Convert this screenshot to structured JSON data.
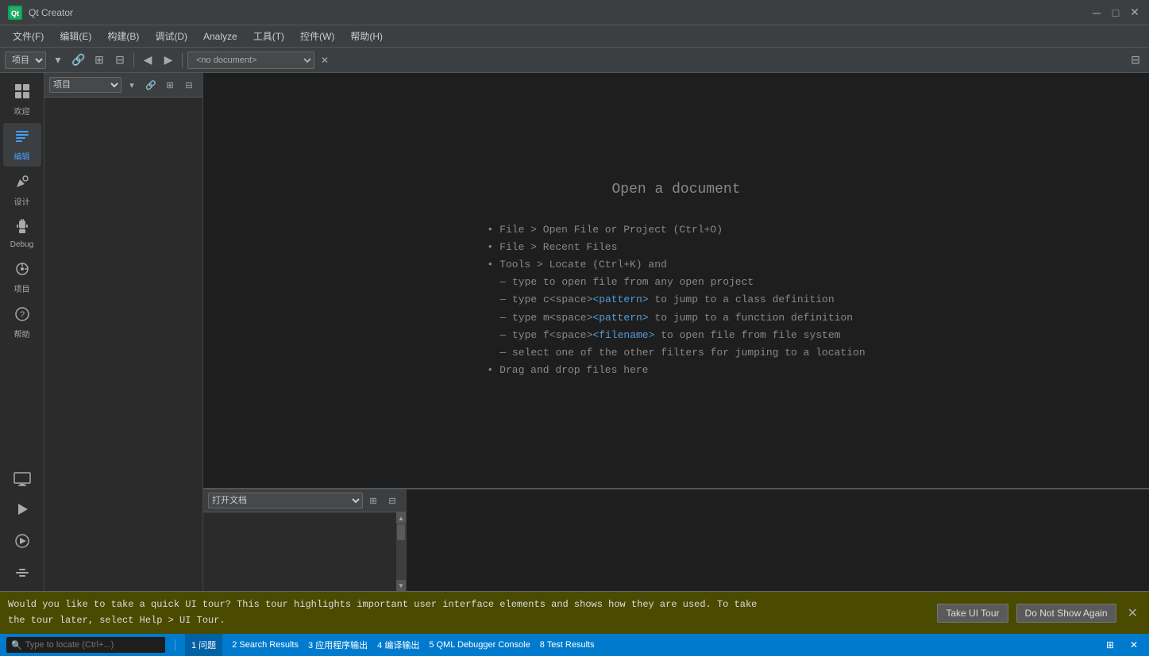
{
  "titleBar": {
    "logo": "Qt",
    "title": "Qt Creator",
    "minimize": "─",
    "maximize": "□",
    "close": "✕"
  },
  "menuBar": {
    "items": [
      {
        "label": "文件(F)"
      },
      {
        "label": "编辑(E)"
      },
      {
        "label": "构建(B)"
      },
      {
        "label": "调试(D)"
      },
      {
        "label": "Analyze"
      },
      {
        "label": "工具(T)"
      },
      {
        "label": "控件(W)"
      },
      {
        "label": "帮助(H)"
      }
    ]
  },
  "toolbar": {
    "projectSelect": "项目",
    "docSelect": "<no document>",
    "prevBtn": "◀",
    "nextBtn": "▶",
    "collapseBtn": "⊟"
  },
  "sidebar": {
    "items": [
      {
        "label": "欢迎",
        "icon": "⊞",
        "active": false
      },
      {
        "label": "编辑",
        "icon": "≡",
        "active": true
      },
      {
        "label": "设计",
        "icon": "✏",
        "active": false
      },
      {
        "label": "Debug",
        "icon": "🐛",
        "active": false
      },
      {
        "label": "项目",
        "icon": "⚙",
        "active": false
      },
      {
        "label": "帮助",
        "icon": "?",
        "active": false
      }
    ]
  },
  "leftPanel": {
    "select": "项目"
  },
  "openDocument": {
    "title": "Open a document",
    "hints": [
      {
        "bullet": "•",
        "text": "File > Open File or Project (Ctrl+O)"
      },
      {
        "bullet": "•",
        "text": "File > Recent Files"
      },
      {
        "bullet": "•",
        "text": "Tools > Locate (Ctrl+K) and"
      },
      {
        "sub": "— type to open file from any open project"
      },
      {
        "sub": "— type c<space><pattern> to jump to a class definition",
        "highlight": true
      },
      {
        "sub": "— type m<space><pattern> to jump to a function definition",
        "highlight": true
      },
      {
        "sub": "— type f<space><filename> to open file from file system",
        "highlight": true
      },
      {
        "sub": "— select one of the other filters for jumping to a location"
      },
      {
        "bullet": "•",
        "text": "Drag and drop files here"
      }
    ]
  },
  "bottomPanel": {
    "select": "打开文档"
  },
  "notification": {
    "text_line1": "Would you like to take a quick UI tour? This tour highlights important user interface elements and shows how they are used. To take",
    "text_line2": "the tour later, select Help > UI Tour.",
    "btn1": "Take UI Tour",
    "btn2": "Do Not Show Again",
    "closeBtn": "✕"
  },
  "statusBar": {
    "tabItems": [
      {
        "label": "1 问题",
        "active": true
      },
      {
        "label": "2 Search Results"
      },
      {
        "label": "3 应用程序输出"
      },
      {
        "label": "4 编译输出"
      },
      {
        "label": "5 QML Debugger Console"
      },
      {
        "label": "8 Test Results"
      }
    ],
    "locatePlaceholder": "Type to locate (Ctrl+...)",
    "locateIcon": "🔍"
  },
  "colors": {
    "accent": "#007acc",
    "background": "#2b2b2b",
    "editorBg": "#1e1e1e",
    "toolbarBg": "#3c3f41",
    "notifBg": "#4a4a00",
    "highlightBlue": "#569cd6"
  }
}
